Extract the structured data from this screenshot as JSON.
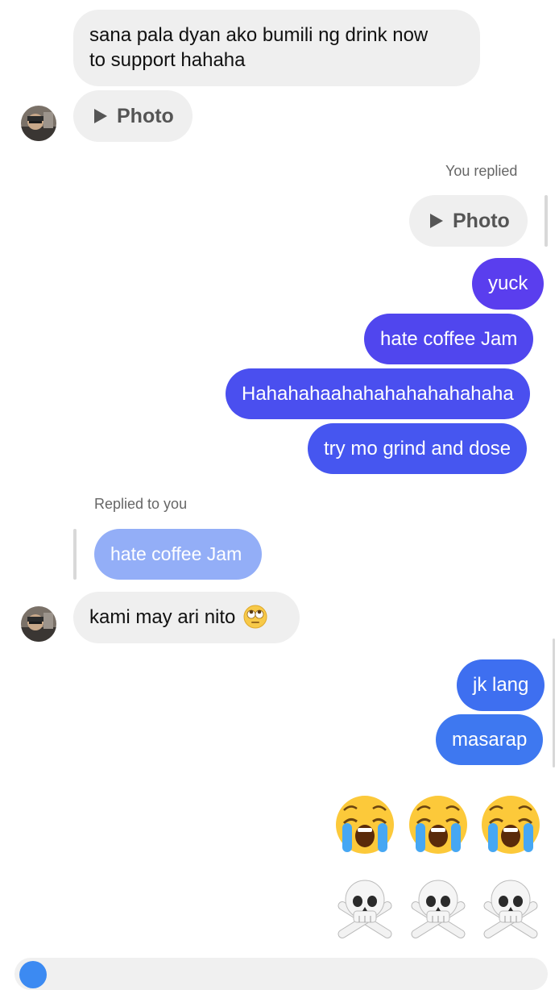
{
  "messages": {
    "m1_line1": "sana pala dyan ako bumili ng drink now",
    "m1_line2": "to support hahaha",
    "photo_in_label": "Photo",
    "you_replied_label": "You replied",
    "photo_out_label": "Photo",
    "out1": "yuck",
    "out2": "hate coffee Jam",
    "out3": "Hahahahaahahahahahahahaha",
    "out4": "try mo grind and dose",
    "replied_to_you_label": "Replied to you",
    "quoted_reply": "hate coffee Jam",
    "in_reply": "kami may ari nito",
    "out5": "jk lang",
    "out6": "masarap"
  },
  "emoji": {
    "rolling_eyes": "rolling-eyes-emoji",
    "crying_row": [
      "loudly-crying-face",
      "loudly-crying-face",
      "loudly-crying-face"
    ],
    "skull_row": [
      "skull-and-crossbones",
      "skull-and-crossbones",
      "skull-and-crossbones"
    ]
  },
  "colors": {
    "incoming_bubble": "#efefef",
    "outgoing_top": "#5543ee",
    "outgoing_bottom": "#3f72f0",
    "quoted_bubble": "#93aef7",
    "meta_text": "#666666"
  }
}
